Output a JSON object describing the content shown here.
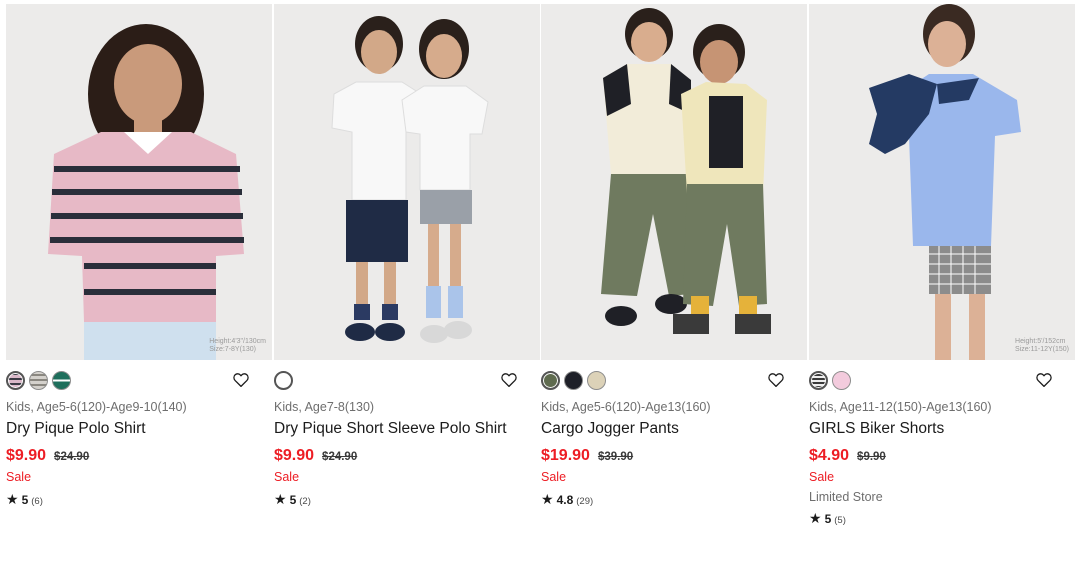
{
  "products": [
    {
      "image_alt": "Girl in pink striped polo shirt",
      "image_note_1": "Height:4'3\"/130cm",
      "image_note_2": "Size:7-8Y(130)",
      "swatch_colors": [
        "#d9b7c8",
        "#c9c6c2",
        "#1f6f5c"
      ],
      "category": "Kids, Age5-6(120)-Age9-10(140)",
      "name": "Dry Pique Polo Shirt",
      "price": "$9.90",
      "original_price": "$24.90",
      "sale_label": "Sale",
      "limited_label": "",
      "rating": "5",
      "review_count": "(6)"
    },
    {
      "image_alt": "Two kids in white polo shirts",
      "image_note_1": "",
      "image_note_2": "",
      "swatch_colors": [
        "#ffffff"
      ],
      "category": "Kids, Age7-8(130)",
      "name": "Dry Pique Short Sleeve Polo Shirt",
      "price": "$9.90",
      "original_price": "$24.90",
      "sale_label": "Sale",
      "limited_label": "",
      "rating": "5",
      "review_count": "(2)"
    },
    {
      "image_alt": "Two kids in cargo jogger pants",
      "image_note_1": "",
      "image_note_2": "",
      "swatch_colors": [
        "#5f6b4f",
        "#1e2028",
        "#dcd2b8"
      ],
      "category": "Kids, Age5-6(120)-Age13(160)",
      "name": "Cargo Jogger Pants",
      "price": "$19.90",
      "original_price": "$39.90",
      "sale_label": "Sale",
      "limited_label": "",
      "rating": "4.8",
      "review_count": "(29)"
    },
    {
      "image_alt": "Girl in blue tee and checked biker shorts",
      "image_note_1": "Height:5'/152cm",
      "image_note_2": "Size:11-12Y(150)",
      "swatch_colors": [
        "#3a3a3a",
        "#f3cbdd"
      ],
      "category": "Kids, Age11-12(150)-Age13(160)",
      "name": "GIRLS Biker Shorts",
      "price": "$4.90",
      "original_price": "$9.90",
      "sale_label": "Sale",
      "limited_label": "Limited Store",
      "rating": "5",
      "review_count": "(5)"
    }
  ],
  "icons": {
    "favorite": "heart-outline-icon",
    "rating": "star-icon"
  },
  "colors": {
    "sale_red": "#ed1d24",
    "text": "#1b1b1b",
    "muted": "#6e6e6e"
  }
}
